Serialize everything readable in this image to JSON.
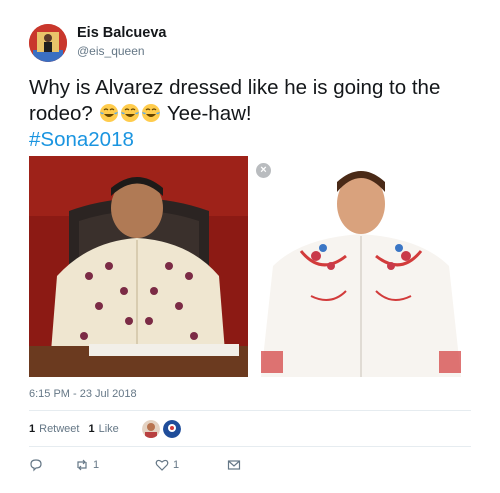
{
  "author": {
    "display_name": "Eis Balcueva",
    "username": "@eis_queen",
    "avatar_icon": "profile-avatar-icon"
  },
  "tweet": {
    "text": "Why is Alvarez dressed like he is going to the rodeo?",
    "emojis": [
      "face-with-tears-of-joy",
      "face-with-tears-of-joy",
      "face-with-tears-of-joy"
    ],
    "text_after": "Yee-haw!",
    "hashtag": "#Sona2018"
  },
  "media": {
    "close_icon": "×"
  },
  "timestamp": "6:15 PM - 23 Jul 2018",
  "stats": {
    "retweets_count": "1",
    "retweets_label": "Retweet",
    "likes_count": "1",
    "likes_label": "Like"
  },
  "actions": {
    "reply_icon": "reply-icon",
    "retweet_icon": "retweet-icon",
    "retweet_count": "1",
    "like_icon": "heart-icon",
    "like_count": "1",
    "dm_icon": "envelope-icon"
  },
  "colors": {
    "hashtag": "#1b95e0",
    "secondary_text": "#657786",
    "divider": "#e6ecf0"
  }
}
